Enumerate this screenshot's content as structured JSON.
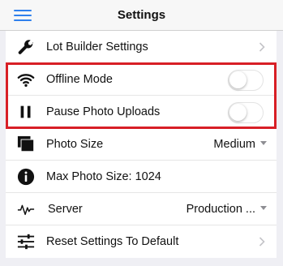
{
  "navbar": {
    "title": "Settings",
    "menu_icon": "hamburger-menu-icon",
    "accent": "#2f80ed"
  },
  "settings": {
    "lot_builder": {
      "label": "Lot Builder Settings",
      "icon": "wrench-icon"
    },
    "offline_mode": {
      "label": "Offline Mode",
      "icon": "wifi-icon",
      "enabled": false
    },
    "pause_uploads": {
      "label": "Pause Photo Uploads",
      "icon": "pause-icon",
      "enabled": false
    },
    "photo_size": {
      "label": "Photo Size",
      "icon": "photos-icon",
      "value": "Medium"
    },
    "max_photo_size": {
      "label": "Max Photo Size: 1024",
      "icon": "info-icon"
    },
    "server": {
      "label": "Server",
      "icon": "pulse-icon",
      "value": "Production ..."
    },
    "reset": {
      "label": "Reset Settings To Default",
      "icon": "sliders-icon"
    }
  },
  "highlight_color": "#d81f26"
}
